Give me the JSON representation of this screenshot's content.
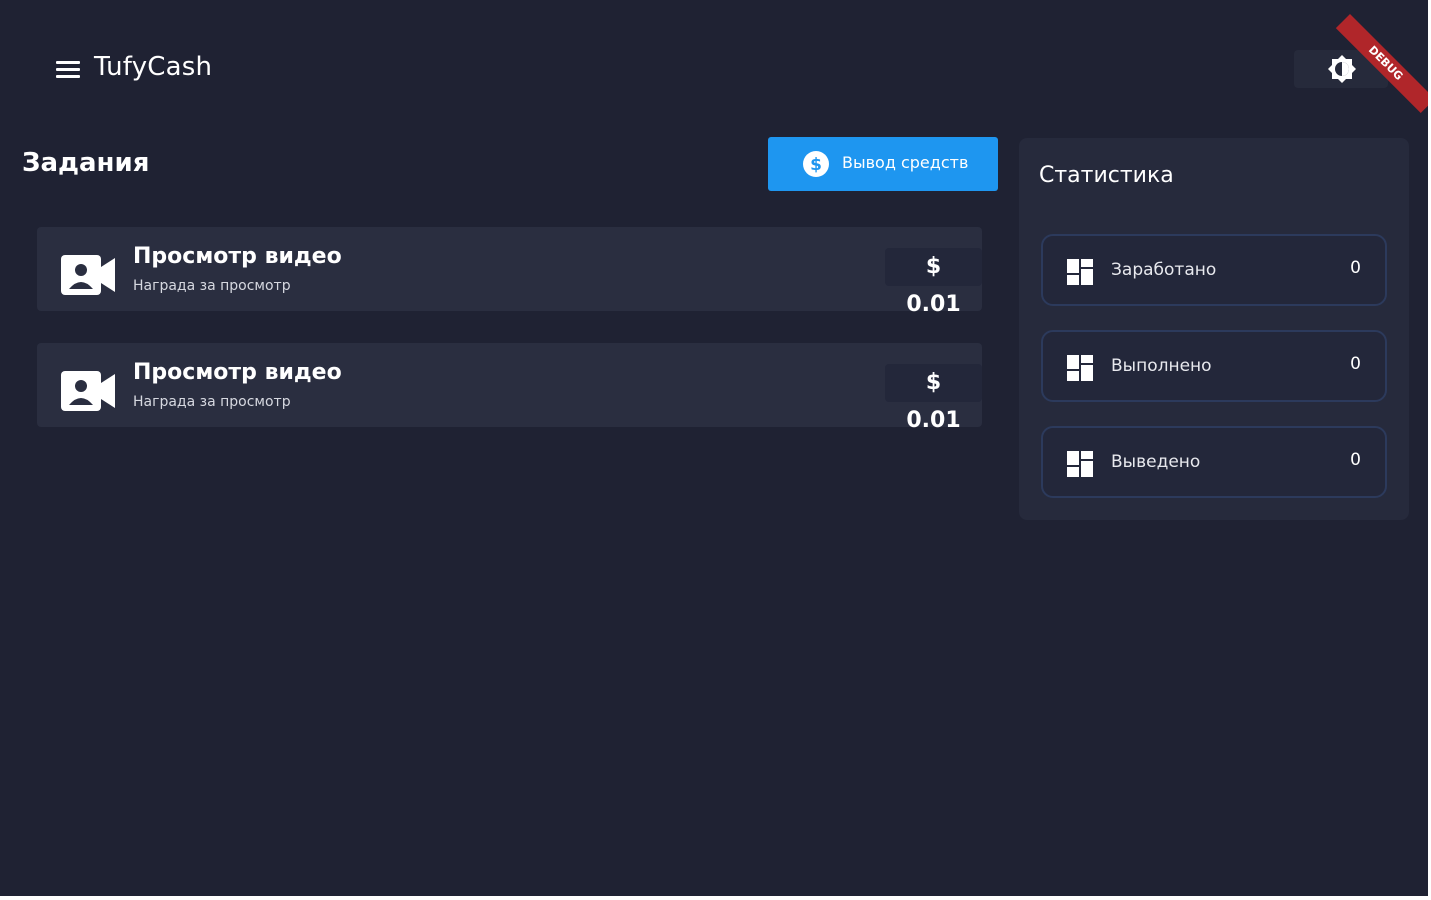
{
  "appbar": {
    "title": "TufyCash",
    "debug_banner": "DEBUG"
  },
  "tasks": {
    "title": "Задания",
    "withdraw_label": "Вывод средств",
    "items": [
      {
        "title": "Просмотр видео",
        "subtitle": "Награда за просмотр",
        "price": "$ 0.01"
      },
      {
        "title": "Просмотр видео",
        "subtitle": "Награда за просмотр",
        "price": "$ 0.01"
      }
    ]
  },
  "stats": {
    "title": "Статистика",
    "items": [
      {
        "label": "Заработано",
        "value": "0"
      },
      {
        "label": "Выполнено",
        "value": "0"
      },
      {
        "label": "Выведено",
        "value": "0"
      }
    ]
  },
  "colors": {
    "background": "#1f2233",
    "card": "#2a2e40",
    "accent": "#1e96f0",
    "debug": "#b0262a"
  },
  "icons": {
    "menu": "menu-icon",
    "theme": "brightness-icon",
    "withdraw": "dollar-circle-icon",
    "task": "video-camera-icon",
    "stat": "dashboard-icon"
  }
}
